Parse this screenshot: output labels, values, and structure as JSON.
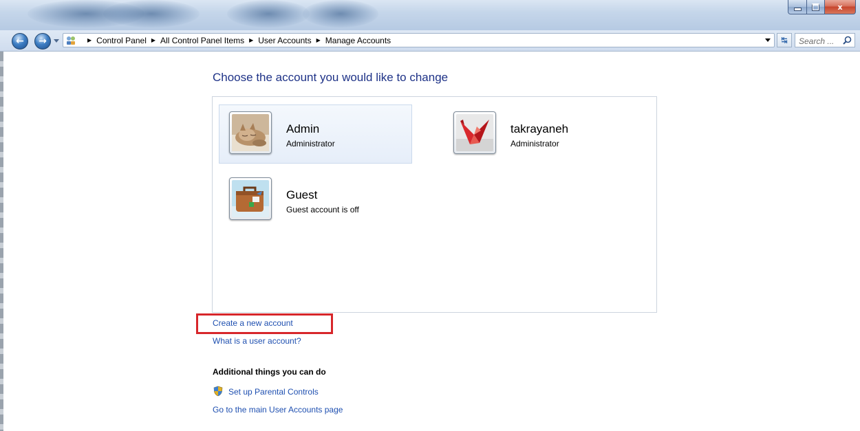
{
  "window": {
    "buttons": {
      "minimize": "–",
      "maximize": "□",
      "close": "x"
    }
  },
  "address_bar": {
    "breadcrumbs": [
      "Control Panel",
      "All Control Panel Items",
      "User Accounts",
      "Manage Accounts"
    ],
    "search_placeholder": "Search ..."
  },
  "main": {
    "title": "Choose the account you would like to change",
    "accounts": [
      {
        "name": "Admin",
        "role": "Administrator",
        "picture": "kitten",
        "selected": true
      },
      {
        "name": "takrayaneh",
        "role": "Administrator",
        "picture": "red-origami-crane",
        "selected": false
      },
      {
        "name": "Guest",
        "role": "Guest account is off",
        "picture": "suitcase",
        "selected": false
      }
    ],
    "links": {
      "create_account": "Create a new account",
      "what_is_account": "What is a user account?"
    },
    "additional": {
      "heading": "Additional things you can do",
      "parental_controls": "Set up Parental Controls",
      "main_page": "Go to the main User Accounts page"
    }
  },
  "colors": {
    "link": "#1e4fb0",
    "title": "#1e3287",
    "highlight_box": "#d7262a",
    "selected_tile": "#e6eef9"
  },
  "icons": {
    "back": "back-arrow-icon",
    "forward": "forward-arrow-icon",
    "control_panel": "control-panel-icon",
    "refresh": "refresh-icon",
    "search": "search-icon",
    "shield": "uac-shield-icon"
  }
}
